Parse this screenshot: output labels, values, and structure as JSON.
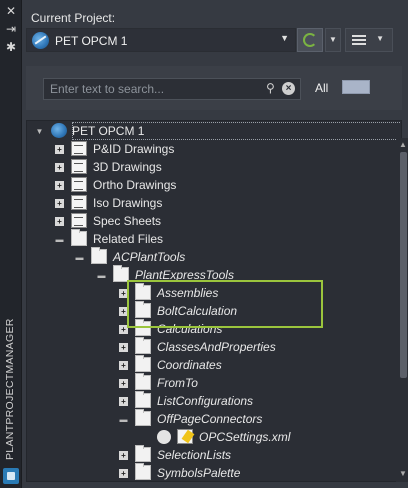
{
  "palette": {
    "title": "PLANTPROJECTMANAGER",
    "icons": [
      "close-icon",
      "auto-hide-icon",
      "settings-icon",
      "app-icon"
    ]
  },
  "header": {
    "current_project_label": "Current Project:",
    "project_name": "PET OPCM 1"
  },
  "search": {
    "placeholder": "Enter text to search...",
    "filter_label": "All"
  },
  "tree": {
    "root": "PET OPCM 1",
    "items": [
      {
        "label": "P&ID Drawings"
      },
      {
        "label": "3D Drawings"
      },
      {
        "label": "Ortho Drawings"
      },
      {
        "label": "Iso Drawings"
      },
      {
        "label": "Spec Sheets"
      },
      {
        "label": "Related Files"
      },
      {
        "label": "ACPlantTools"
      },
      {
        "label": "PlantExpressTools"
      },
      {
        "label": "Assemblies"
      },
      {
        "label": "BoltCalculation"
      },
      {
        "label": "Calculations"
      },
      {
        "label": "ClassesAndProperties"
      },
      {
        "label": "Coordinates"
      },
      {
        "label": "FromTo"
      },
      {
        "label": "ListConfigurations"
      },
      {
        "label": "OffPageConnectors"
      },
      {
        "label": "OPCSettings.xml"
      },
      {
        "label": "SelectionLists"
      },
      {
        "label": "SymbolsPalette"
      }
    ]
  },
  "colors": {
    "highlight": "#9bc53d",
    "panel": "#363a42",
    "tree_bg": "#2b2e35"
  }
}
